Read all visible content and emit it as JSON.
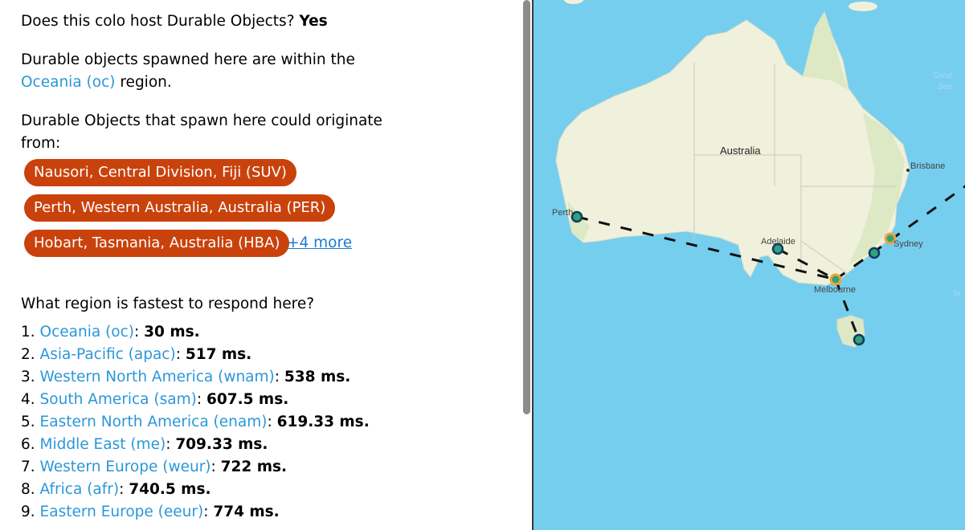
{
  "durable": {
    "host_question": "Does this colo host Durable Objects?",
    "host_answer": "Yes",
    "region_prefix": "Durable objects spawned here are within the",
    "region_link": "Oceania (oc)",
    "region_suffix": "region.",
    "origin_line1": "Durable Objects that spawn here could originate",
    "origin_line2": "from:",
    "origins": [
      "Nausori, Central Division, Fiji (SUV)",
      "Perth, Western Australia, Australia (PER)",
      "Hobart, Tasmania, Australia (HBA)"
    ],
    "more_link": "+4 more"
  },
  "fastest": {
    "question": "What region is fastest to respond here?",
    "items": [
      {
        "num": "1. ",
        "region": "Oceania (oc)",
        "time": "30 ms."
      },
      {
        "num": "2. ",
        "region": "Asia-Pacific (apac)",
        "time": "517 ms."
      },
      {
        "num": "3. ",
        "region": "Western North America (wnam)",
        "time": "538 ms."
      },
      {
        "num": "4. ",
        "region": "South America (sam)",
        "time": "607.5 ms."
      },
      {
        "num": "5. ",
        "region": "Eastern North America (enam)",
        "time": "619.33 ms."
      },
      {
        "num": "6. ",
        "region": "Middle East (me)",
        "time": "709.33 ms."
      },
      {
        "num": "7. ",
        "region": "Western Europe (weur)",
        "time": "722 ms."
      },
      {
        "num": "8. ",
        "region": "Africa (afr)",
        "time": "740.5 ms."
      },
      {
        "num": "9. ",
        "region": "Eastern Europe (eeur)",
        "time": "774 ms."
      }
    ]
  },
  "map": {
    "country_label": "Australia",
    "cities": [
      "Perth",
      "Adelaide",
      "Melbourne",
      "Sydney",
      "Brisbane"
    ],
    "sea_label_1": "Coral",
    "sea_label_2": "Sea",
    "sea_label_3": "Ta",
    "colors": {
      "water": "#76ceee",
      "land": "#f0f1dc",
      "land_green": "#dde8c4",
      "marker_fill": "#2fa37a",
      "marker_stroke": "#123a63",
      "home_ring": "#f2a33a"
    }
  }
}
